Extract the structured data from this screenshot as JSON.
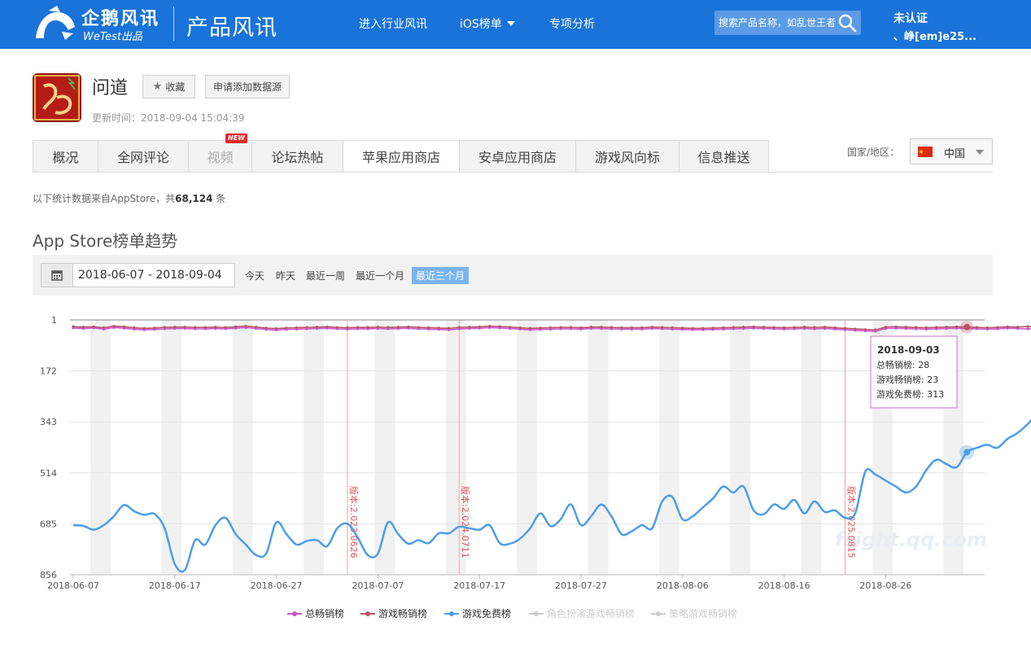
{
  "header": {
    "logo_cn": "企鹅风讯",
    "logo_en": "WeTest出品",
    "product_title": "产品风讯",
    "nav": [
      {
        "label": "进入行业风讯"
      },
      {
        "label": "iOS榜单"
      },
      {
        "label": "专项分析"
      }
    ],
    "search_placeholder": "搜索产品名称，如乱世王者",
    "user_status": "未认证",
    "user_name": "、峥[em]e25..."
  },
  "app": {
    "name": "问道",
    "favorite_label": "收藏",
    "add_source_label": "申请添加数据源",
    "update_time": "更新时间：2018-09-04 15:04:39"
  },
  "tabs": [
    {
      "label": "概况"
    },
    {
      "label": "全网评论"
    },
    {
      "label": "视频",
      "badge": "NEW"
    },
    {
      "label": "论坛热帖"
    },
    {
      "label": "苹果应用商店"
    },
    {
      "label": "安卓应用商店"
    },
    {
      "label": "游戏风向标"
    },
    {
      "label": "信息推送"
    }
  ],
  "active_tab": "苹果应用商店",
  "region": {
    "label": "国家/地区：",
    "value": "中国"
  },
  "stats": {
    "prefix": "以下统计数据来自AppStore，共",
    "count": "68,124",
    "suffix": " 条"
  },
  "section_title": "App Store榜单趋势",
  "date_filter": {
    "range": "2018-06-07 - 2018-09-04",
    "quick": [
      "今天",
      "昨天",
      "最近一周",
      "最近一个月",
      "最近三个月"
    ],
    "active": "最近三个月"
  },
  "chart_data": {
    "type": "line",
    "y_inverted": true,
    "ylim": [
      1,
      856
    ],
    "yticks": [
      "1",
      "172",
      "343",
      "514",
      "685",
      "856"
    ],
    "xticks": [
      "2018-06-07",
      "2018-06-17",
      "2018-06-27",
      "2018-07-07",
      "2018-07-17",
      "2018-07-27",
      "2018-08-06",
      "2018-08-16",
      "2018-08-26"
    ],
    "x_start": "2018-06-07",
    "watermark": "fsight.qq.com",
    "series": [
      {
        "name": "总畅销榜",
        "color": "#cc55cc",
        "visible": true,
        "values": [
          28,
          30,
          28,
          32,
          27,
          29,
          32,
          34,
          33,
          31,
          30,
          30,
          31,
          31,
          30,
          31,
          29,
          27,
          30,
          33,
          35,
          33,
          32,
          31,
          30,
          29,
          31,
          32,
          31,
          31,
          30,
          31,
          30,
          29,
          31,
          32,
          33,
          34,
          31,
          30,
          29,
          27,
          28,
          30,
          32,
          34,
          33,
          32,
          31,
          31,
          32,
          30,
          30,
          31,
          32,
          32,
          32,
          30,
          31,
          32,
          33,
          34,
          34,
          33,
          32,
          31,
          30,
          29,
          30,
          31,
          32,
          31,
          30,
          31,
          30,
          32,
          34,
          36,
          38,
          39,
          30,
          29,
          30,
          31,
          32,
          31,
          30,
          29,
          30,
          31,
          32,
          31,
          29,
          30,
          31,
          28
        ]
      },
      {
        "name": "游戏畅销榜",
        "color": "#b8546a",
        "visible": true,
        "values": [
          23,
          25,
          24,
          27,
          22,
          24,
          27,
          29,
          28,
          26,
          25,
          25,
          26,
          26,
          25,
          26,
          24,
          22,
          25,
          28,
          30,
          28,
          27,
          26,
          25,
          24,
          26,
          27,
          26,
          26,
          25,
          26,
          25,
          24,
          26,
          27,
          28,
          29,
          26,
          25,
          24,
          22,
          23,
          25,
          27,
          29,
          28,
          27,
          26,
          26,
          27,
          25,
          25,
          26,
          27,
          27,
          27,
          25,
          26,
          27,
          28,
          29,
          29,
          28,
          27,
          26,
          25,
          24,
          25,
          26,
          27,
          26,
          25,
          26,
          25,
          27,
          29,
          31,
          33,
          34,
          25,
          24,
          25,
          26,
          27,
          26,
          25,
          24,
          25,
          26,
          27,
          26,
          24,
          25,
          23,
          26
        ]
      },
      {
        "name": "游戏免费榜",
        "color": "#4d9de8",
        "visible": true,
        "values": [
          690,
          692,
          705,
          690,
          660,
          622,
          643,
          655,
          652,
          700,
          820,
          840,
          740,
          755,
          690,
          665,
          720,
          755,
          790,
          785,
          680,
          720,
          755,
          743,
          740,
          760,
          700,
          685,
          730,
          790,
          785,
          680,
          720,
          752,
          740,
          750,
          717,
          717,
          695,
          700,
          705,
          690,
          750,
          752,
          735,
          700,
          650,
          693,
          670,
          620,
          690,
          660,
          620,
          660,
          720,
          710,
          690,
          700,
          610,
          595,
          670,
          660,
          630,
          600,
          560,
          580,
          560,
          640,
          653,
          620,
          635,
          605,
          650,
          610,
          645,
          640,
          665,
          650,
          510,
          520,
          540,
          560,
          580,
          560,
          505,
          470,
          485,
          495,
          445,
          430,
          420,
          430,
          400,
          380,
          350,
          313
        ]
      },
      {
        "name": "角色扮演游戏畅销榜",
        "color": "#cccccc",
        "visible": false
      },
      {
        "name": "策略游戏畅销榜",
        "color": "#cccccc",
        "visible": false
      }
    ],
    "annotations": [
      {
        "date": "2018-07-04",
        "label": "版本:2.023.0626"
      },
      {
        "date": "2018-07-15",
        "label": "版本:2.024.0711"
      },
      {
        "date": "2018-08-22",
        "label": "版本:2.025.0815"
      }
    ],
    "tooltip": {
      "date": "2018-09-03",
      "rows": [
        "总畅销榜: 28",
        "游戏畅销榜: 23",
        "游戏免费榜: 313"
      ]
    }
  },
  "colors": {
    "header_bg": "#1a73d9",
    "accent": "#4d9de8"
  }
}
